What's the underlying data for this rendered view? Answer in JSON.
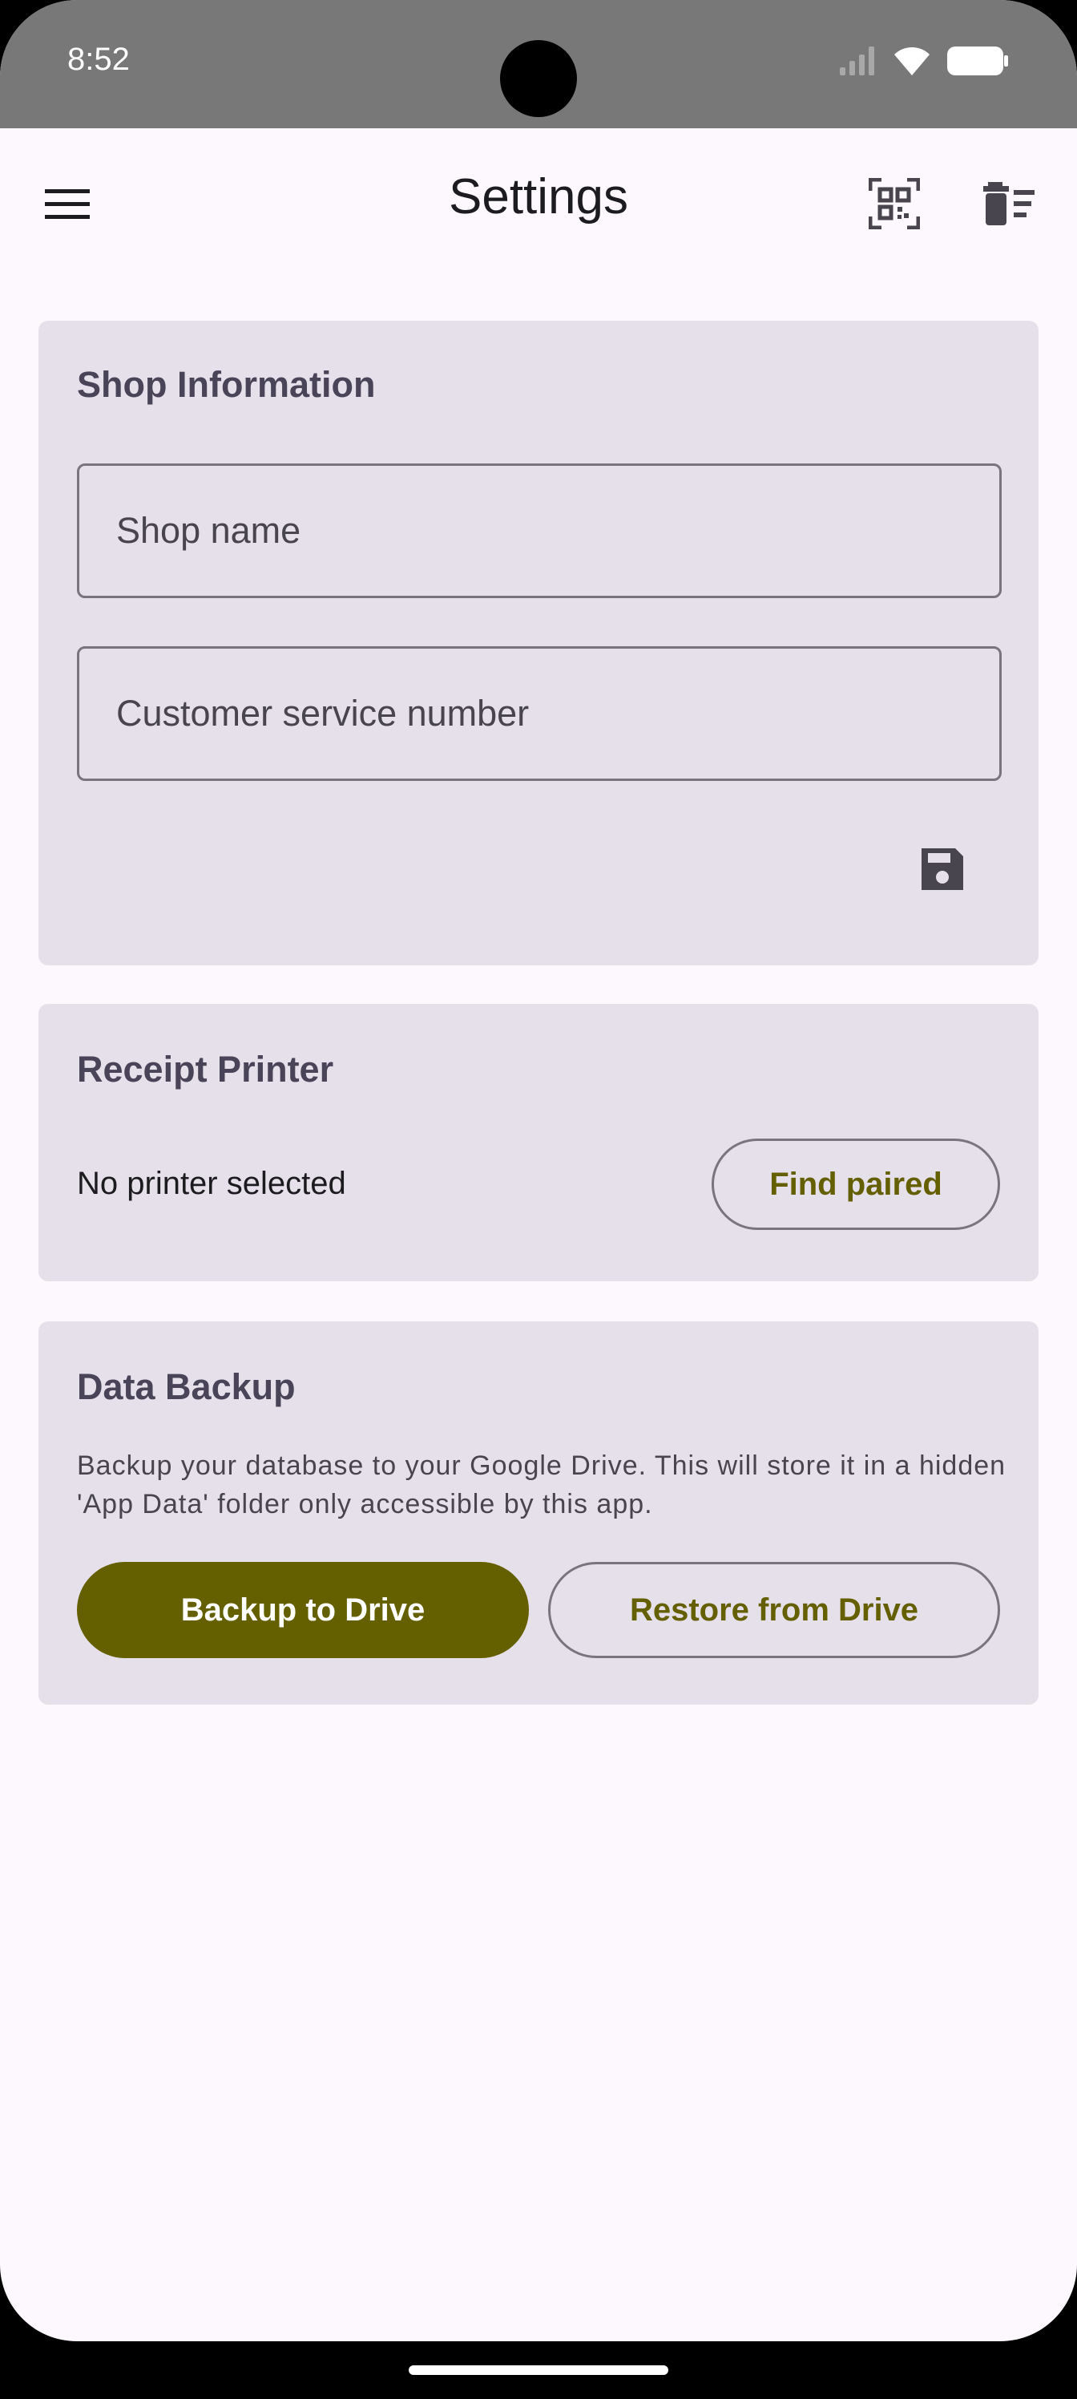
{
  "status_bar": {
    "time": "8:52",
    "icons": [
      "signal-icon",
      "wifi-icon",
      "battery-icon"
    ]
  },
  "app_bar": {
    "title": "Settings",
    "menu_icon": "hamburger-menu-icon",
    "actions": [
      "qr-code-scan-icon",
      "delete-sweep-icon"
    ]
  },
  "shop_info": {
    "title": "Shop Information",
    "shop_name_placeholder": "Shop name",
    "shop_name_value": "",
    "customer_service_placeholder": "Customer service number",
    "customer_service_value": "",
    "save_icon": "save-icon"
  },
  "receipt_printer": {
    "title": "Receipt Printer",
    "status": "No printer selected",
    "find_button": "Find paired"
  },
  "data_backup": {
    "title": "Data Backup",
    "description": "Backup your database to your Google Drive. This will store it in a hidden 'App Data' folder only accessible by this app.",
    "backup_button": "Backup to Drive",
    "restore_button": "Restore from Drive"
  },
  "colors": {
    "surface": "#FDF8FD",
    "card": "#E6E0EB",
    "primary": "#646000",
    "outline": "#79747E",
    "status_bar": "#787878"
  }
}
